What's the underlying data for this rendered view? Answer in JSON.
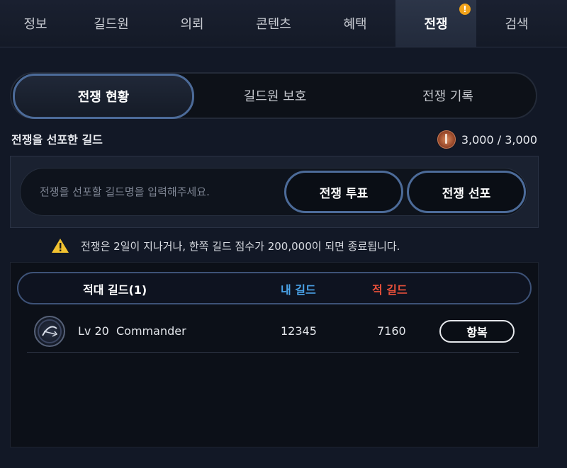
{
  "top_tabs": [
    "정보",
    "길드원",
    "의뢰",
    "콘텐츠",
    "혜택",
    "전쟁",
    "검색"
  ],
  "top_tab_active": "전쟁",
  "top_tab_badge": "!",
  "sub_tabs": [
    "전쟁 현황",
    "길드원 보호",
    "전쟁 기록"
  ],
  "sub_tab_active": "전쟁 현황",
  "declared_section": {
    "title": "전쟁을 선포한 길드",
    "points": "3,000 / 3,000"
  },
  "search": {
    "placeholder": "전쟁을 선포할 길드명을 입력해주세요.",
    "value": ""
  },
  "buttons": {
    "vote": "전쟁 투표",
    "declare": "전쟁 선포",
    "surrender": "항복"
  },
  "notice": "전쟁은 2일이 지나거나, 한쪽 길드 점수가 200,000이 되면 종료됩니다.",
  "table": {
    "headers": {
      "enemy": "적대 길드(1)",
      "mine": "내 길드",
      "theirs": "적 길드"
    },
    "rows": [
      {
        "level": "Lv 20",
        "name": "Commander",
        "my_score": "12345",
        "enemy_score": "7160"
      }
    ]
  },
  "colors": {
    "mine_header": "#4aa3e8",
    "theirs_header": "#e8503a",
    "accent_border": "#4c6b99",
    "badge": "#f0a21a"
  }
}
